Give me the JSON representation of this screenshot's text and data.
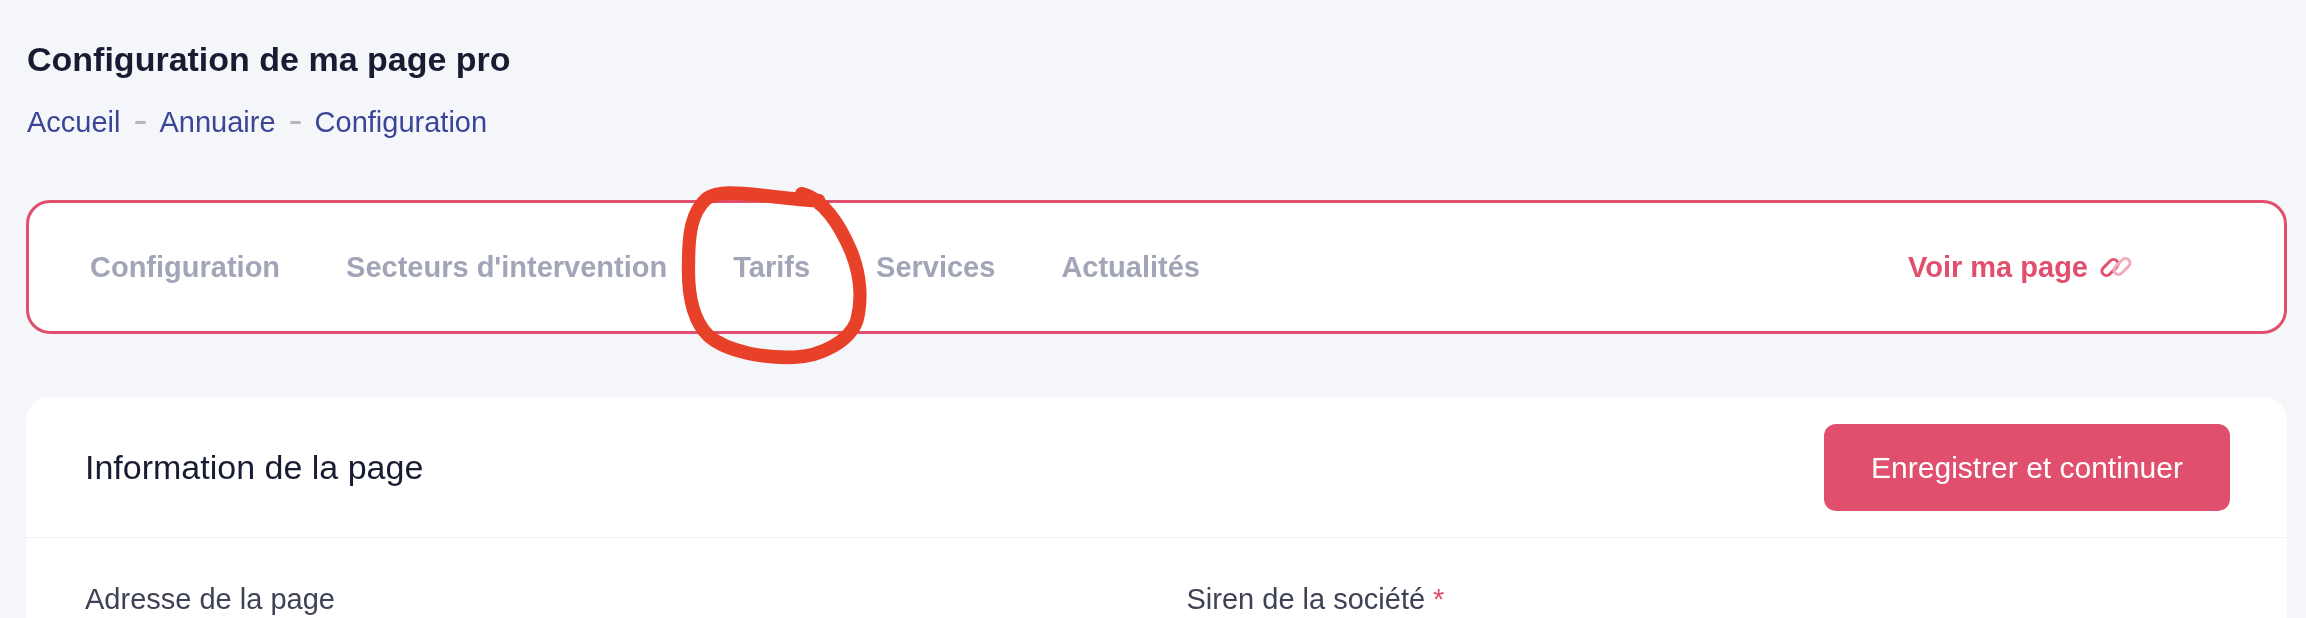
{
  "page_title": "Configuration de ma page pro",
  "breadcrumb": [
    "Accueil",
    "Annuaire",
    "Configuration"
  ],
  "tabs": [
    {
      "label": "Configuration",
      "selected": false,
      "circled": false
    },
    {
      "label": "Secteurs d'intervention",
      "selected": false,
      "circled": false
    },
    {
      "label": "Tarifs",
      "selected": false,
      "circled": true
    },
    {
      "label": "Services",
      "selected": false,
      "circled": false
    },
    {
      "label": "Actualités",
      "selected": false,
      "circled": false
    }
  ],
  "view_page_link": {
    "label": "Voir ma page"
  },
  "card": {
    "title": "Information de la page",
    "save_button": "Enregistrer et continuer",
    "fields": [
      {
        "label": "Adresse de la page"
      },
      {
        "label": "Siren de la société",
        "required_mark": "*"
      }
    ]
  }
}
